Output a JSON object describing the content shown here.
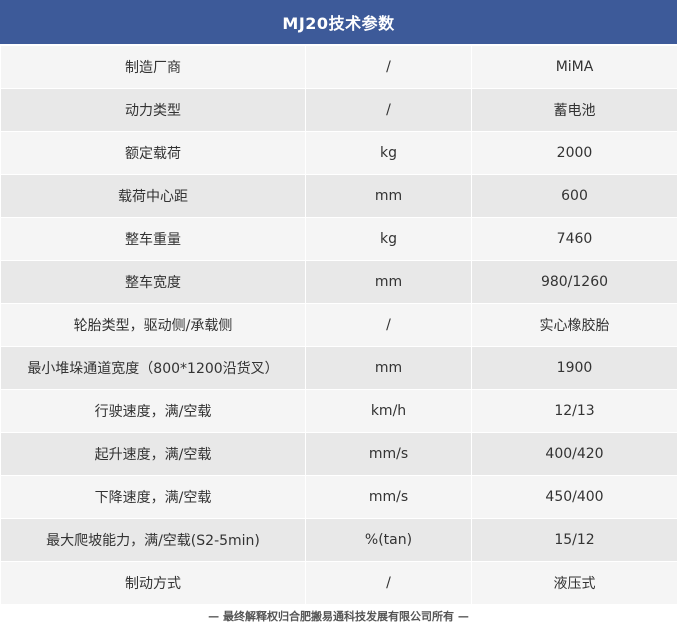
{
  "title": "MJ20技术参数",
  "rows": [
    {
      "name": "制造厂商",
      "unit": "/",
      "value": "MiMA"
    },
    {
      "name": "动力类型",
      "unit": "/",
      "value": "蓄电池"
    },
    {
      "name": "额定载荷",
      "unit": "kg",
      "value": "2000"
    },
    {
      "name": "载荷中心距",
      "unit": "mm",
      "value": "600"
    },
    {
      "name": "整车重量",
      "unit": "kg",
      "value": "7460"
    },
    {
      "name": "整车宽度",
      "unit": "mm",
      "value": "980/1260"
    },
    {
      "name": "轮胎类型，驱动侧/承载侧",
      "unit": "/",
      "value": "实心橡胶胎"
    },
    {
      "name": "最小堆垛通道宽度（800*1200沿货叉）",
      "unit": "mm",
      "value": "1900"
    },
    {
      "name": "行驶速度，满/空载",
      "unit": "km/h",
      "value": "12/13"
    },
    {
      "name": "起升速度，满/空载",
      "unit": "mm/s",
      "value": "400/420"
    },
    {
      "name": "下降速度，满/空载",
      "unit": "mm/s",
      "value": "450/400"
    },
    {
      "name": "最大爬坡能力，满/空载(S2-5min)",
      "unit": "%(tan)",
      "value": "15/12"
    },
    {
      "name": "制动方式",
      "unit": "/",
      "value": "液压式"
    }
  ],
  "footer": "— 最终解释权归合肥搬易通科技发展有限公司所有 —",
  "colors": {
    "header": "#3d5a99",
    "row_light": "#f5f5f5",
    "row_dark": "#e8e8e8"
  }
}
